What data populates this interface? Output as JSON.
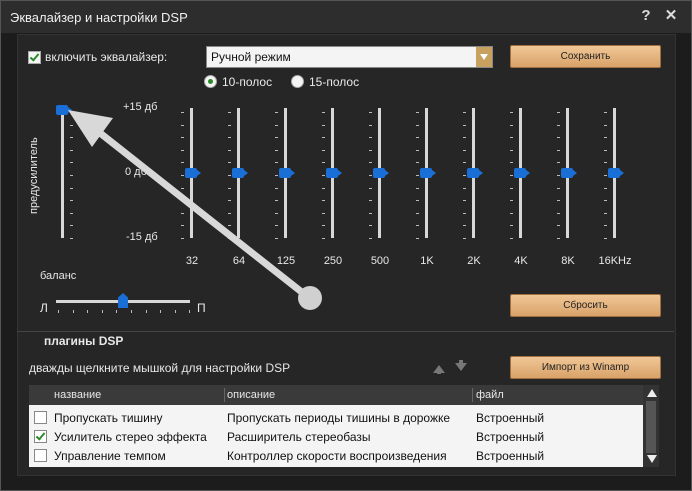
{
  "window": {
    "title": "Эквалайзер и настройки DSP",
    "help_icon": "?",
    "close_icon": "✕"
  },
  "equalizer": {
    "enable_label": "включить эквалайзер:",
    "enabled": true,
    "preset_value": "Ручной режим",
    "save_label": "Сохранить",
    "reset_label": "Сбросить",
    "mode_10": "10-полос",
    "mode_15": "15-полос",
    "selected_mode": "10-полос",
    "preamp_label": "предусилитель",
    "db_top": "+15 дб",
    "db_mid": "0 дб",
    "db_bottom": "-15 дб",
    "preamp_level_db": 15,
    "bands": [
      {
        "freq": "32",
        "level_db": 0
      },
      {
        "freq": "64",
        "level_db": 0
      },
      {
        "freq": "125",
        "level_db": 0
      },
      {
        "freq": "250",
        "level_db": 0
      },
      {
        "freq": "500",
        "level_db": 0
      },
      {
        "freq": "1K",
        "level_db": 0
      },
      {
        "freq": "2K",
        "level_db": 0
      },
      {
        "freq": "4K",
        "level_db": 0
      },
      {
        "freq": "8K",
        "level_db": 0
      },
      {
        "freq": "16KHz",
        "level_db": 0
      }
    ],
    "balance_label": "баланс",
    "balance_left": "Л",
    "balance_right": "П",
    "balance_value": 0
  },
  "dsp": {
    "section_label": "плагины DSP",
    "hint": "дважды щелкните мышкой для настройки DSP",
    "import_label": "Импорт из Winamp",
    "columns": [
      "название",
      "описание",
      "файл"
    ],
    "rows": [
      {
        "checked": false,
        "name": "Пропускать тишину",
        "description": "Пропускать периоды тишины в дорожке",
        "file": "Встроенный"
      },
      {
        "checked": true,
        "name": "Усилитель стерео эффекта",
        "description": "Расширитель стереобазы",
        "file": "Встроенный"
      },
      {
        "checked": false,
        "name": "Управление темпом",
        "description": "Контроллер скорости воспроизведения",
        "file": "Встроенный"
      }
    ]
  },
  "colors": {
    "accent_blue": "#1a6fd6",
    "button_orange": "#d9a269",
    "check_green": "#2a8a2a"
  }
}
